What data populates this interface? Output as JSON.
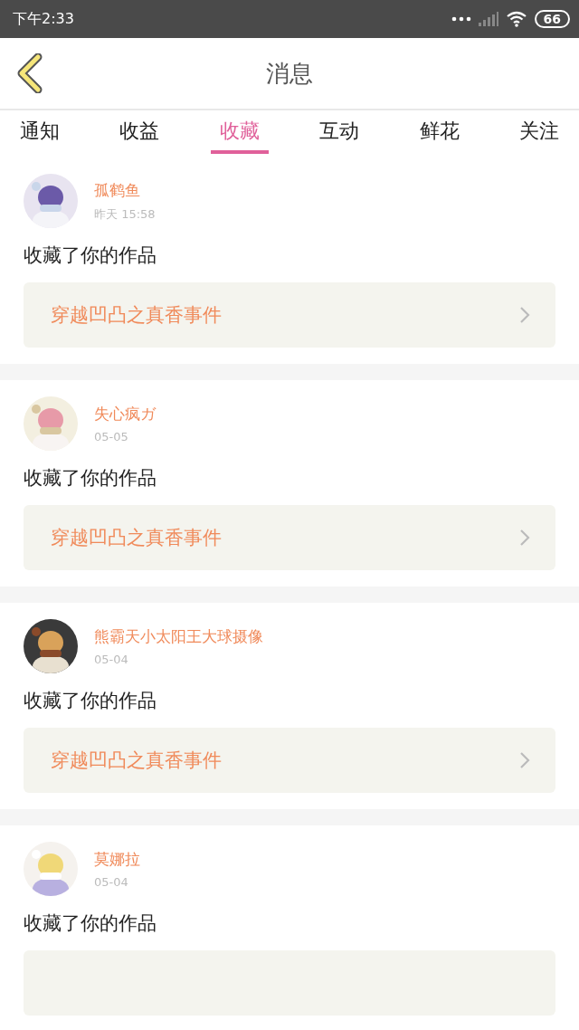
{
  "status_bar": {
    "time": "下午2:33",
    "battery": "66"
  },
  "header": {
    "title": "消息"
  },
  "tabs": [
    {
      "label": "通知",
      "selected": false
    },
    {
      "label": "收益",
      "selected": false
    },
    {
      "label": "收藏",
      "selected": true
    },
    {
      "label": "互动",
      "selected": false
    },
    {
      "label": "鲜花",
      "selected": false
    },
    {
      "label": "关注",
      "selected": false
    }
  ],
  "messages": [
    {
      "name": "孤鹤鱼",
      "time": "昨天 15:58",
      "text": "收藏了你的作品",
      "work": "穿越凹凸之真香事件"
    },
    {
      "name": "失心疯ガ",
      "time": "05-05",
      "text": "收藏了你的作品",
      "work": "穿越凹凸之真香事件"
    },
    {
      "name": "熊霸天小太阳王大球摄像",
      "time": "05-04",
      "text": "收藏了你的作品",
      "work": "穿越凹凸之真香事件"
    },
    {
      "name": "莫娜拉",
      "time": "05-04",
      "text": "收藏了你的作品"
    }
  ]
}
